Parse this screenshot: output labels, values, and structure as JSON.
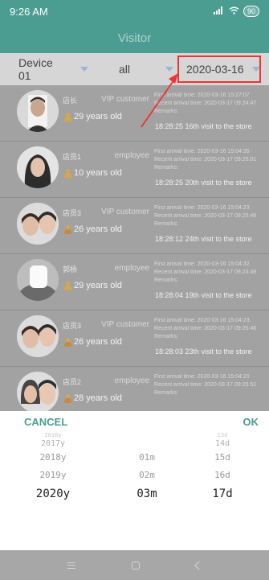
{
  "status_bar": {
    "time": "9:26 AM",
    "battery": "90"
  },
  "header": {
    "title": "Visitor"
  },
  "filters": {
    "device": "Device 01",
    "type": "all",
    "date": "2020-03-16"
  },
  "visitors": [
    {
      "name": "店长",
      "role": "VIP customer",
      "age": "29 years old",
      "gender": "male",
      "first": "First arrival time: 2020-03-16 15:27:07",
      "recent": "Recent arrival time: 2020-03-17 09:24:47",
      "remarks": "Remarks:",
      "visit": "18:28:25  16th visit to the store"
    },
    {
      "name": "店员1",
      "role": "employee",
      "age": "10 years old",
      "gender": "male",
      "first": "First arrival time: 2020-03-16 15:04:35",
      "recent": "Recent arrival time: 2020-03-17 09:26:01",
      "remarks": "Remarks:",
      "visit": "18:28:25  20th visit to the store"
    },
    {
      "name": "店员3",
      "role": "VIP customer",
      "age": "26 years old",
      "gender": "female",
      "first": "First arrival time: 2020-03-16 15:04:23",
      "recent": "Recent arrival time: 2020-03-17 09:25:46",
      "remarks": "Remarks:",
      "visit": "18:28:12  24th visit to the store"
    },
    {
      "name": "郭杨",
      "role": "employee",
      "age": "29 years old",
      "gender": "male",
      "first": "First arrival time: 2020-03-16 15:04:32",
      "recent": "Recent arrival time: 2020-03-17 09:24:49",
      "remarks": "Remarks:",
      "visit": "18:28:04  19th visit to the store"
    },
    {
      "name": "店员3",
      "role": "VIP customer",
      "age": "26 years old",
      "gender": "female",
      "first": "First arrival time: 2020-03-16 15:04:23",
      "recent": "Recent arrival time: 2020-03-17 09:25:46",
      "remarks": "Remarks:",
      "visit": "18:28:03  23th visit to the store"
    },
    {
      "name": "店员2",
      "role": "employee",
      "age": "28 years old",
      "gender": "female",
      "first": "First arrival time: 2020-03-16 15:04:20",
      "recent": "Recent arrival time: 2020-03-17 09:25:51",
      "remarks": "Remarks:",
      "visit": ""
    }
  ],
  "picker": {
    "cancel": "CANCEL",
    "ok": "OK",
    "years": [
      "2016y",
      "2017y",
      "2018y",
      "2019y",
      "2020y"
    ],
    "months": [
      "01m",
      "02m",
      "03m"
    ],
    "days": [
      "13d",
      "14d",
      "15d",
      "16d",
      "17d"
    ]
  },
  "colors": {
    "accent": "#4a9d90",
    "highlight": "#ee3333"
  }
}
